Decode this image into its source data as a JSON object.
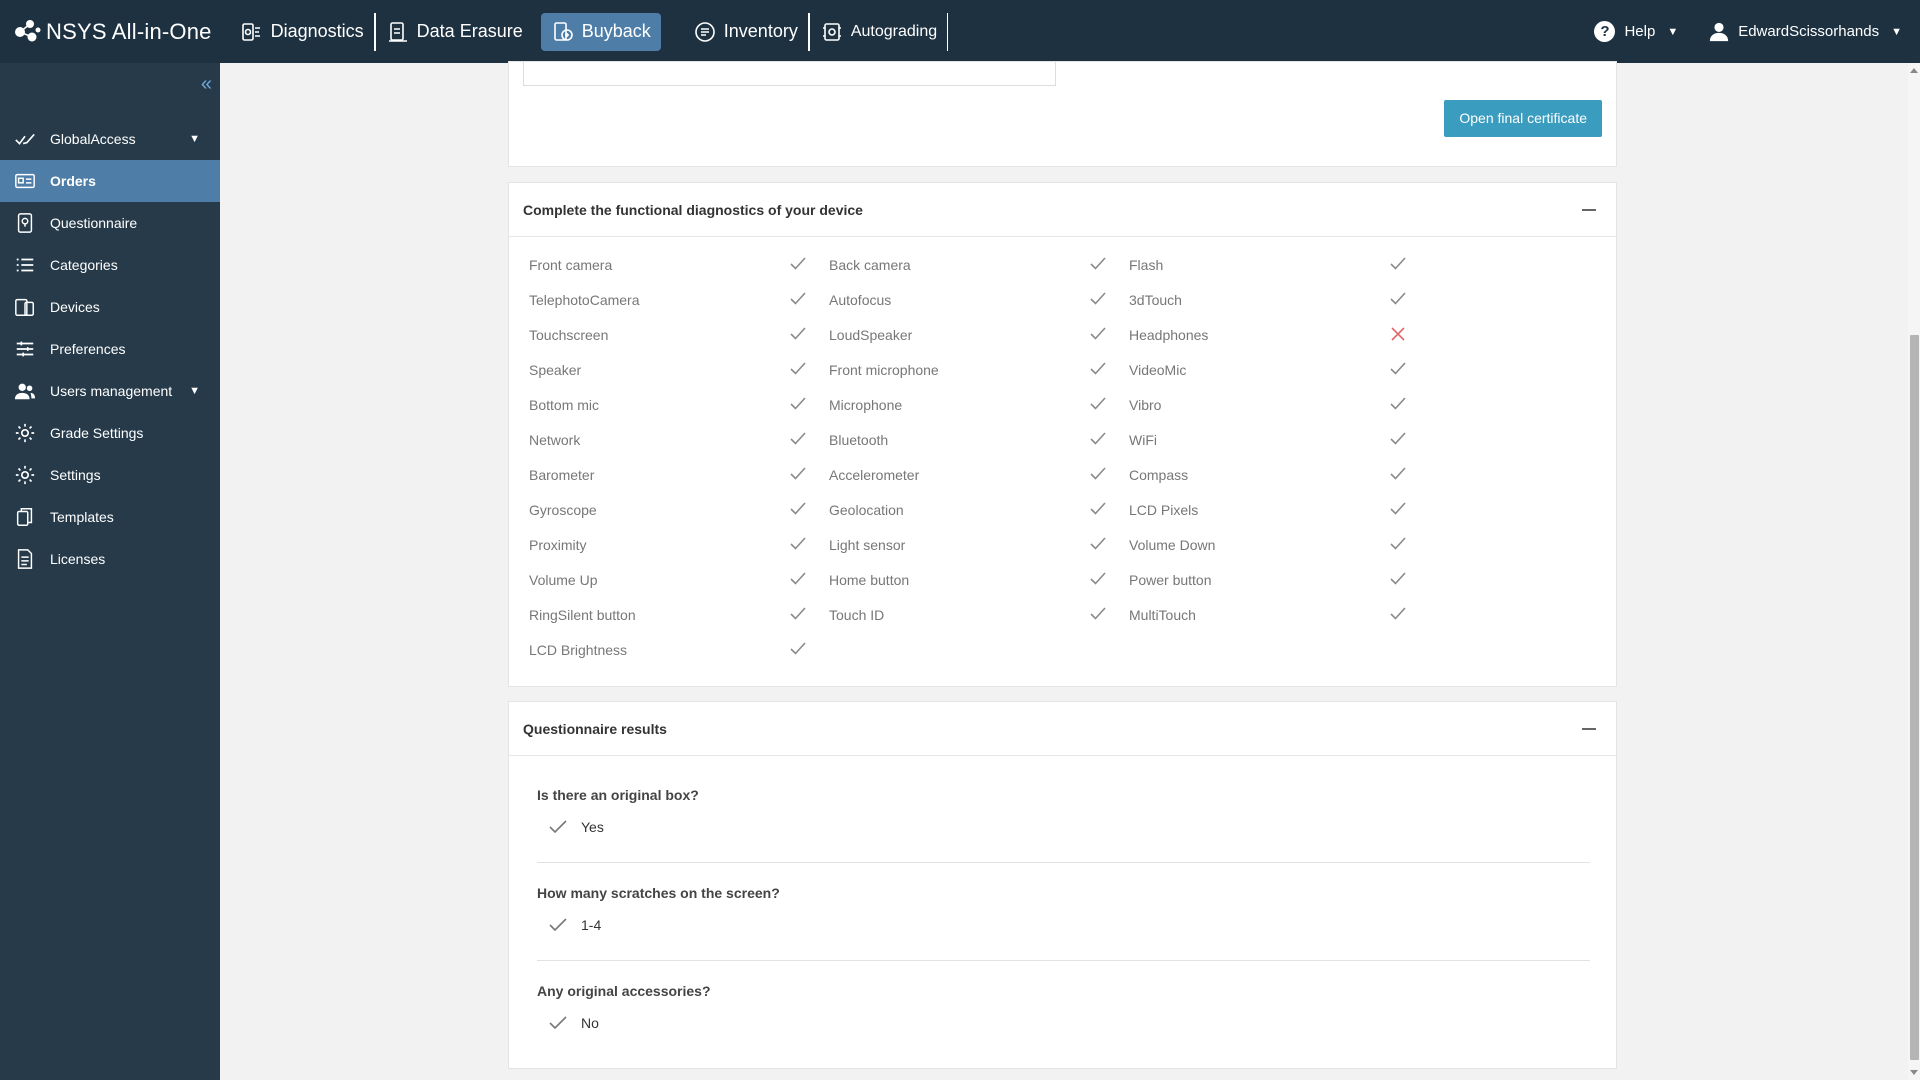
{
  "topbar": {
    "brand": "NSYS All-in-One",
    "nav": [
      {
        "label": "Diagnostics",
        "icon": "diagnostics-icon"
      },
      {
        "label": "Data Erasure",
        "icon": "data-erasure-icon"
      },
      {
        "label": "Buyback",
        "icon": "buyback-icon",
        "active": true
      },
      {
        "label": "Inventory",
        "icon": "inventory-icon"
      },
      {
        "label": "Autograding",
        "icon": "autograding-icon"
      }
    ],
    "help_label": "Help",
    "user_name": "EdwardScissorhands"
  },
  "sidebar": {
    "items": [
      {
        "label": "GlobalAccess",
        "icon": "global-access-icon",
        "has_caret": true
      },
      {
        "label": "Orders",
        "icon": "orders-icon",
        "active": true
      },
      {
        "label": "Questionnaire",
        "icon": "questionnaire-icon"
      },
      {
        "label": "Categories",
        "icon": "list-icon"
      },
      {
        "label": "Devices",
        "icon": "devices-icon"
      },
      {
        "label": "Preferences",
        "icon": "sliders-icon"
      },
      {
        "label": "Users management",
        "icon": "users-icon",
        "has_caret": true
      },
      {
        "label": "Grade Settings",
        "icon": "gear-icon"
      },
      {
        "label": "Settings",
        "icon": "gear-icon"
      },
      {
        "label": "Templates",
        "icon": "templates-icon"
      },
      {
        "label": "Licenses",
        "icon": "document-icon"
      }
    ]
  },
  "certificate": {
    "button_label": "Open final certificate"
  },
  "diagnostics": {
    "title": "Complete the functional diagnostics of your device",
    "columns": [
      [
        {
          "label": "Front camera",
          "pass": true
        },
        {
          "label": "TelephotoCamera",
          "pass": true
        },
        {
          "label": "Touchscreen",
          "pass": true
        },
        {
          "label": "Speaker",
          "pass": true
        },
        {
          "label": "Bottom mic",
          "pass": true
        },
        {
          "label": "Network",
          "pass": true
        },
        {
          "label": "Barometer",
          "pass": true
        },
        {
          "label": "Gyroscope",
          "pass": true
        },
        {
          "label": "Proximity",
          "pass": true
        },
        {
          "label": "Volume Up",
          "pass": true
        },
        {
          "label": "RingSilent button",
          "pass": true
        },
        {
          "label": "LCD Brightness",
          "pass": true
        }
      ],
      [
        {
          "label": "Back camera",
          "pass": true
        },
        {
          "label": "Autofocus",
          "pass": true
        },
        {
          "label": "LoudSpeaker",
          "pass": true
        },
        {
          "label": "Front microphone",
          "pass": true
        },
        {
          "label": "Microphone",
          "pass": true
        },
        {
          "label": "Bluetooth",
          "pass": true
        },
        {
          "label": "Accelerometer",
          "pass": true
        },
        {
          "label": "Geolocation",
          "pass": true
        },
        {
          "label": "Light sensor",
          "pass": true
        },
        {
          "label": "Home button",
          "pass": true
        },
        {
          "label": "Touch ID",
          "pass": true
        }
      ],
      [
        {
          "label": "Flash",
          "pass": true
        },
        {
          "label": "3dTouch",
          "pass": true
        },
        {
          "label": "Headphones",
          "pass": false
        },
        {
          "label": "VideoMic",
          "pass": true
        },
        {
          "label": "Vibro",
          "pass": true
        },
        {
          "label": "WiFi",
          "pass": true
        },
        {
          "label": "Compass",
          "pass": true
        },
        {
          "label": "LCD Pixels",
          "pass": true
        },
        {
          "label": "Volume Down",
          "pass": true
        },
        {
          "label": "Power button",
          "pass": true
        },
        {
          "label": "MultiTouch",
          "pass": true
        }
      ]
    ]
  },
  "questionnaire": {
    "title": "Questionnaire results",
    "items": [
      {
        "question": "Is there an original box?",
        "answer": "Yes"
      },
      {
        "question": "How many scratches on the screen?",
        "answer": "1-4"
      },
      {
        "question": "Any original accessories?",
        "answer": "No"
      }
    ]
  },
  "colors": {
    "topbar": "#1d3141",
    "sidebar": "#263a4a",
    "active": "#4e7ea8",
    "primary_button": "#3a9cbf",
    "pass": "#8a8a8a",
    "fail": "#e06666"
  }
}
